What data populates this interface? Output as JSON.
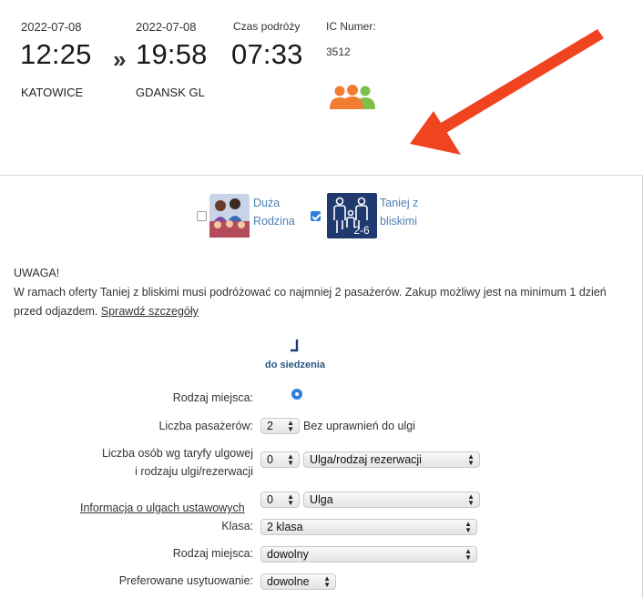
{
  "journey": {
    "departure": {
      "date": "2022-07-08",
      "time": "12:25",
      "station": "KATOWICE"
    },
    "separator": "»",
    "arrival": {
      "date": "2022-07-08",
      "time": "19:58",
      "station": "GDANSK GL"
    },
    "travel_time": {
      "label": "Czas podróży",
      "value": "07:33"
    },
    "train": {
      "label": "IC Numer:",
      "number": "3512",
      "icon": "group-people-icon"
    }
  },
  "offers": [
    {
      "label_line1": "Duża",
      "label_line2": "Rodzina",
      "checked": false,
      "icon": "large-family-icon"
    },
    {
      "label_line1": "Taniej z",
      "label_line2": "bliskimi",
      "checked": true,
      "icon": "family-2-6-icon",
      "badge_text": "2-6"
    }
  ],
  "notice": {
    "title": "UWAGA!",
    "line1": "W ramach oferty Taniej z bliskimi musi podróżować co najmniej 2 pasażerów. Zakup możliwy jest na minimum 1 dzień",
    "line2_prefix": "przed odjazdem. ",
    "link": "Sprawdź szczegóły"
  },
  "seat_type": {
    "caption": "do siedzenia",
    "icon": "seat-icon"
  },
  "form": {
    "seat_kind_label": "Rodzaj miejsca:",
    "passengers_label": "Liczba pasażerów:",
    "passengers_value": "2",
    "passengers_note": "Bez uprawnień do ulgi",
    "discount_persons_label_1": "Liczba osób wg taryfy ulgowej",
    "discount_persons_label_2": "i rodzaju ulgi/rezerwacji",
    "discount_persons_value": "0",
    "discount_type_value": "Ulga/rodzaj rezerwacji",
    "statutory_link": "Informacja o ulgach ustawowych",
    "statutory_value": "0",
    "statutory_type_value": "Ulga",
    "class_label": "Klasa:",
    "class_value": "2 klasa",
    "seat_place_label": "Rodzaj miejsca:",
    "seat_place_value": "dowolny",
    "preferred_label": "Preferowane usytuowanie:",
    "preferred_value": "dowolne"
  },
  "colors": {
    "accent": "#2f7fe0",
    "arrow": "#f0431f",
    "icon_orange": "#f47c32",
    "icon_green": "#7cc04b",
    "badge_navy": "#1f3a6e"
  }
}
